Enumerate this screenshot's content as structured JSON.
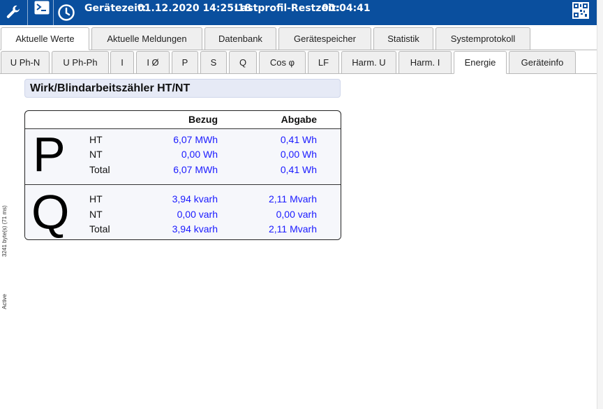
{
  "header": {
    "geraetezeit_label": "Gerätezeit:",
    "geraetezeit_value": "01.12.2020 14:25:18",
    "lastprofil_label": "Lastprofil-Restzeit:",
    "lastprofil_value": "00:04:41",
    "icons": [
      "wrench-icon",
      "terminal-icon",
      "clock-icon",
      "qr-code-icon"
    ]
  },
  "tabs_main": [
    {
      "label": "Aktuelle Werte",
      "active": true
    },
    {
      "label": "Aktuelle Meldungen",
      "active": false
    },
    {
      "label": "Datenbank",
      "active": false
    },
    {
      "label": "Gerätespeicher",
      "active": false
    },
    {
      "label": "Statistik",
      "active": false
    },
    {
      "label": "Systemprotokoll",
      "active": false
    }
  ],
  "tabs_sub": [
    {
      "label": "U Ph-N",
      "active": false
    },
    {
      "label": "U Ph-Ph",
      "active": false
    },
    {
      "label": "I",
      "active": false
    },
    {
      "label": "I Ø",
      "active": false
    },
    {
      "label": "P",
      "active": false
    },
    {
      "label": "S",
      "active": false
    },
    {
      "label": "Q",
      "active": false
    },
    {
      "label": "Cos φ",
      "active": false
    },
    {
      "label": "LF",
      "active": false
    },
    {
      "label": "Harm. U",
      "active": false
    },
    {
      "label": "Harm. I",
      "active": false
    },
    {
      "label": "Energie",
      "active": true
    },
    {
      "label": "Geräteinfo",
      "active": false
    }
  ],
  "section": {
    "title": "Wirk/Blindarbeitszähler HT/NT",
    "col_bezug": "Bezug",
    "col_abgabe": "Abgabe"
  },
  "p_block": {
    "letter": "P",
    "rows": [
      {
        "label": "HT",
        "bezug": "6,07 MWh",
        "abgabe": "0,41 Wh"
      },
      {
        "label": "NT",
        "bezug": "0,00 Wh",
        "abgabe": "0,00 Wh"
      },
      {
        "label": "Total",
        "bezug": "6,07 MWh",
        "abgabe": "0,41 Wh"
      }
    ]
  },
  "q_block": {
    "letter": "Q",
    "rows": [
      {
        "label": "HT",
        "bezug": "3,94 kvarh",
        "abgabe": "2,11 Mvarh"
      },
      {
        "label": "NT",
        "bezug": "0,00 varh",
        "abgabe": "0,00 varh"
      },
      {
        "label": "Total",
        "bezug": "3,94 kvarh",
        "abgabe": "2,11 Mvarh"
      }
    ]
  },
  "side": {
    "bytes": "3241 byte(s) (71 ms)",
    "status": "Active"
  },
  "colors": {
    "topbar": "#0a4f9e",
    "value_blue": "#1a1aff",
    "title_bg": "#e6eaf6"
  }
}
